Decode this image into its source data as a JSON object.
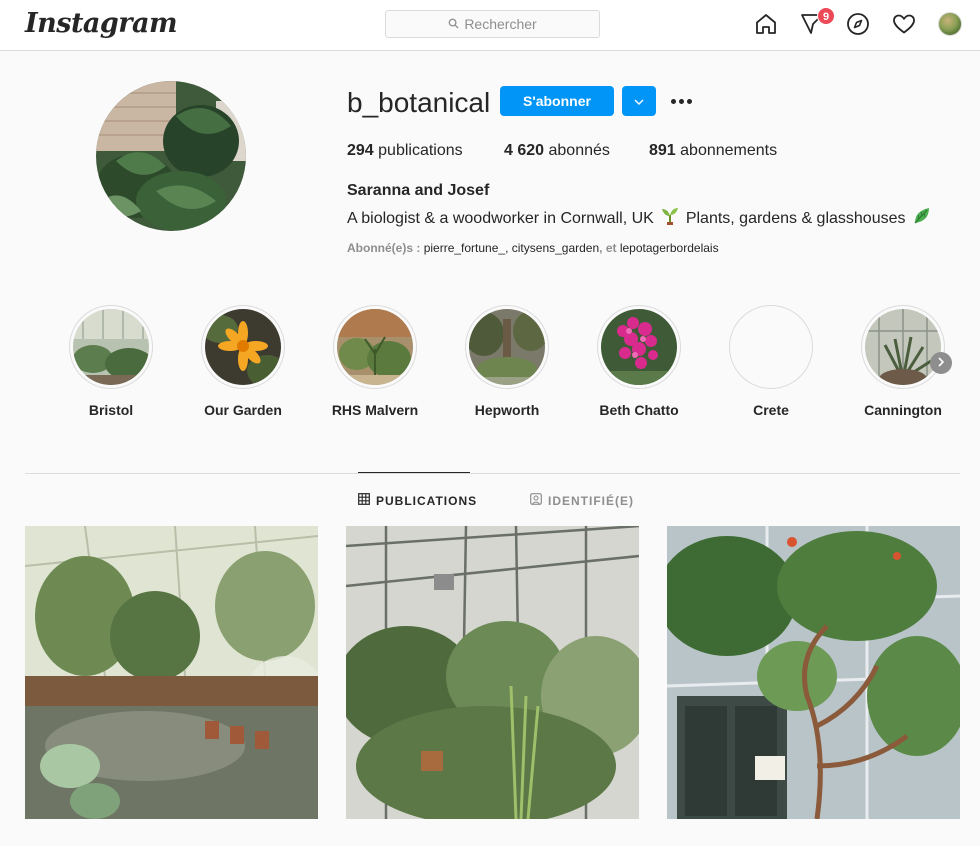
{
  "nav": {
    "logo": "Instagram",
    "search_placeholder": "Rechercher",
    "notification_count": "9"
  },
  "profile": {
    "username": "b_botanical",
    "follow_label": "S'abonner",
    "posts_count": "294",
    "posts_label": "publications",
    "followers_count": "4 620",
    "followers_label": "abonnés",
    "following_count": "891",
    "following_label": "abonnements",
    "full_name": "Saranna and Josef",
    "bio_part1": "A biologist & a woodworker in Cornwall, UK",
    "bio_part2": "Plants, gardens & glasshouses",
    "followed_by_prefix": "Abonné(e)s :",
    "followed_by_users": [
      "pierre_fortune_",
      "citysens_garden",
      "lepotagerbordelais"
    ],
    "followed_by_sep": ",",
    "followed_by_and": ", et"
  },
  "highlights": [
    {
      "label": "Bristol"
    },
    {
      "label": "Our Garden"
    },
    {
      "label": "RHS Malvern"
    },
    {
      "label": "Hepworth"
    },
    {
      "label": "Beth Chatto"
    },
    {
      "label": "Crete"
    },
    {
      "label": "Cannington"
    }
  ],
  "tabs": [
    {
      "label": "PUBLICATIONS",
      "active": true
    },
    {
      "label": "IDENTIFIÉ(E)",
      "active": false
    }
  ],
  "colors": {
    "accent": "#0095f6",
    "badge": "#ed4956",
    "border": "#dbdbdb"
  }
}
